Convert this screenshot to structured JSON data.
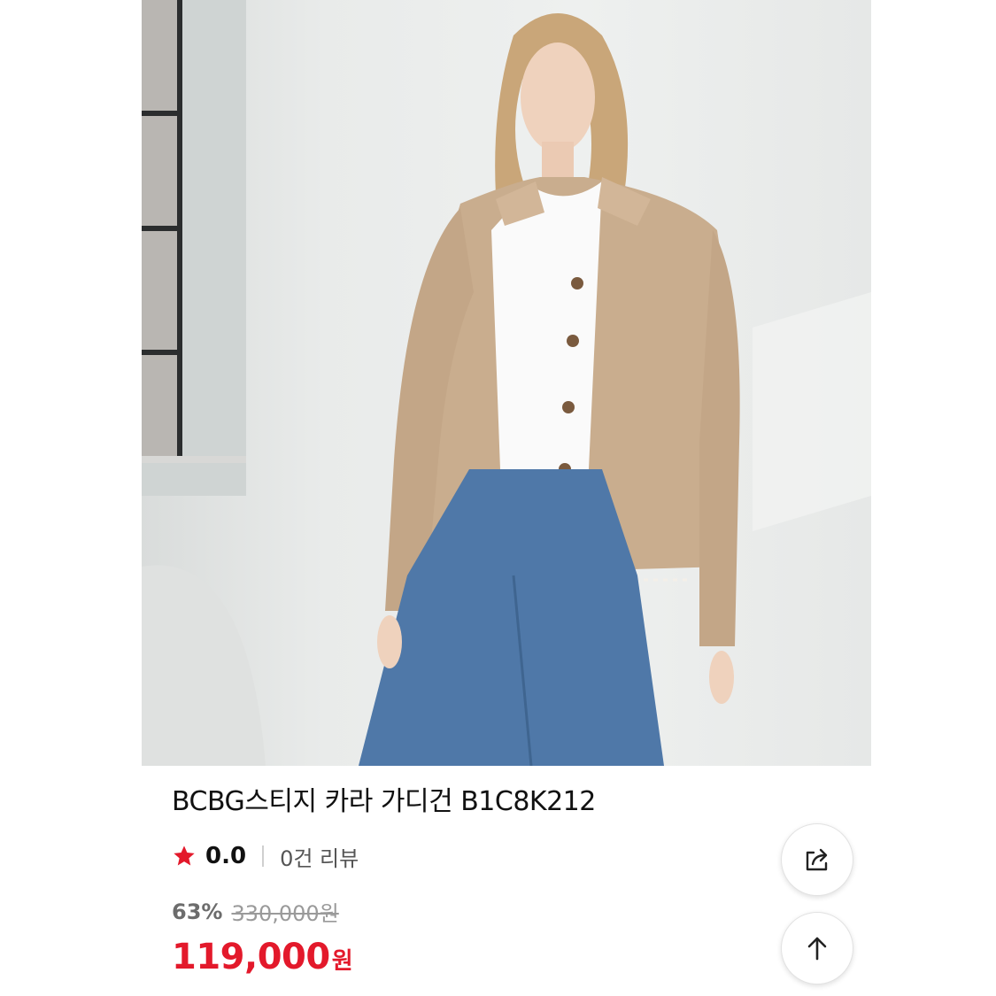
{
  "product": {
    "title": "BCBG스티지 카라 가디건 B1C8K212",
    "rating": "0.0",
    "review_count": "0건 리뷰",
    "discount": "63%",
    "original_price": "330,000원",
    "price": "119,000",
    "currency": "원",
    "image_alt": "product-photo"
  },
  "buttons": {
    "share_icon": "share-icon",
    "top_icon": "arrow-up-icon"
  },
  "colors": {
    "price": "#e3192b",
    "star": "#e3192b"
  }
}
